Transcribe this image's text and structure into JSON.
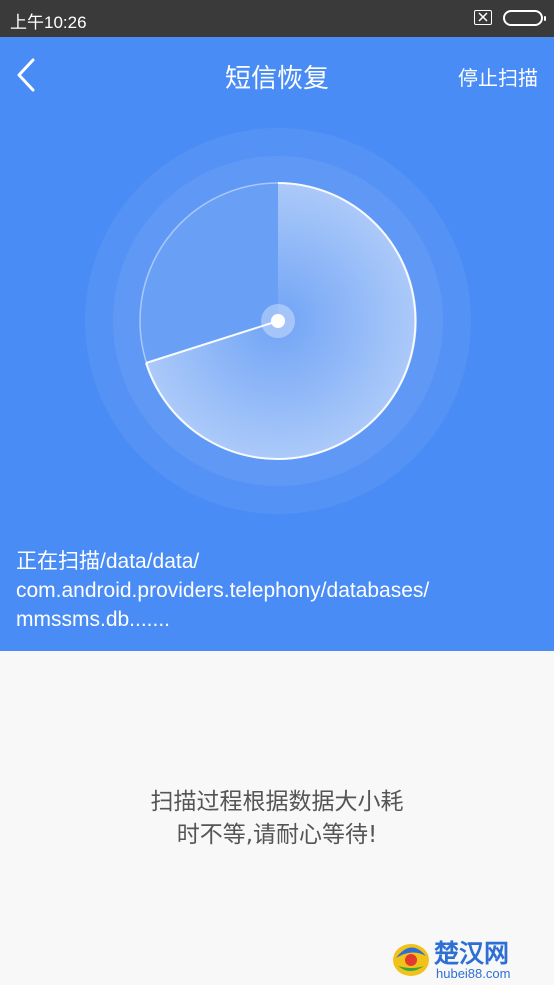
{
  "status_bar": {
    "time": "上午10:26",
    "icons": [
      "sim-card-icon",
      "battery-icon"
    ]
  },
  "header": {
    "back_icon": "chevron-left-icon",
    "title": "短信恢复",
    "stop_label": "停止扫描"
  },
  "scan": {
    "path_lines": [
      "正在扫描/data/data/",
      "com.android.providers.telephony/databases/",
      "mmssms.db......."
    ]
  },
  "hint": {
    "lines": [
      "扫描过程根据数据大小耗",
      "时不等,请耐心等待!"
    ]
  },
  "watermark": {
    "name": "楚汉网",
    "url": "hubei88.com"
  },
  "colors": {
    "accent": "#4a8cf5",
    "status_bar": "#3a3a3a",
    "background": "#f8f8f8",
    "hint_text": "#555555"
  }
}
